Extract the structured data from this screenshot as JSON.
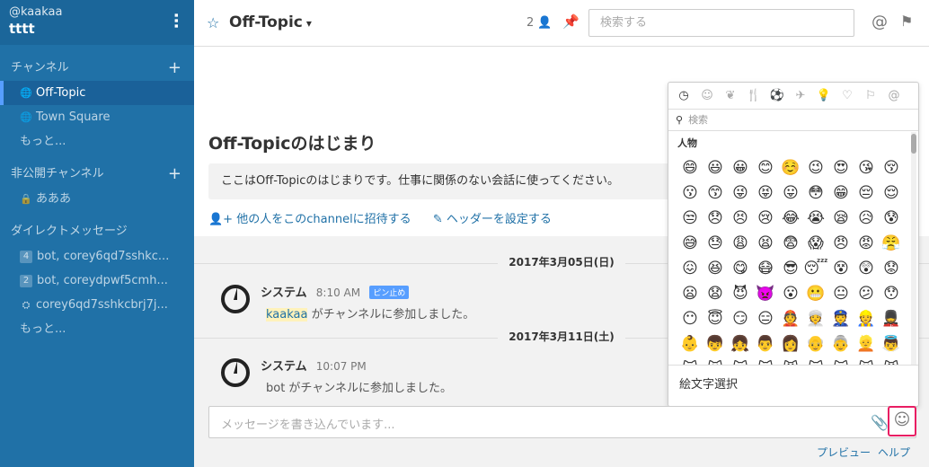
{
  "sidebar": {
    "user": "@kaakaa",
    "team": "tttt",
    "public_heading": "チャンネル",
    "public_items": [
      {
        "label": "Off-Topic",
        "active": true
      },
      {
        "label": "Town Square",
        "active": false
      }
    ],
    "public_more": "もっと...",
    "private_heading": "非公開チャンネル",
    "private_items": [
      {
        "label": "あああ"
      }
    ],
    "dm_heading": "ダイレクトメッセージ",
    "dm_items": [
      {
        "badge": "4",
        "label": "bot, corey6qd7sshkc..."
      },
      {
        "badge": "2",
        "label": "bot, coreydpwf5cmh..."
      },
      {
        "badge": "",
        "label": "corey6qd7sshkcbrj7j..."
      }
    ],
    "dm_more": "もっと..."
  },
  "header": {
    "channel": "Off-Topic",
    "member_count": "2",
    "search_placeholder": "検索する"
  },
  "intro": {
    "title": "Off-Topicのはじまり",
    "description": "ここはOff-Topicのはじまりです。仕事に関係のない会話に使ってください。",
    "invite_link": "他の人をこのchannelに招待する",
    "header_link": "ヘッダーを設定する"
  },
  "posts": [
    {
      "date": "2017年3月05日(日)",
      "user": "システム",
      "time": "8:10 AM",
      "badge": "ピン止め",
      "mention": "kaakaa",
      "text": "がチャンネルに参加しました。"
    },
    {
      "date": "2017年3月11日(土)",
      "user": "システム",
      "time": "10:07 PM",
      "text": "bot がチャンネルに参加しました。"
    }
  ],
  "composer": {
    "placeholder": "メッセージを書き込んでいます..."
  },
  "footer": {
    "preview": "プレビュー",
    "help": "ヘルプ"
  },
  "emoji_picker": {
    "search_placeholder": "検索",
    "category_title": "人物",
    "footer_label": "絵文字選択",
    "categories": [
      "recent-icon",
      "people-icon",
      "nature-icon",
      "food-icon",
      "activity-icon",
      "travel-icon",
      "objects-icon",
      "symbols-icon",
      "flags-icon",
      "custom-icon"
    ],
    "emojis": [
      "😄",
      "😃",
      "😀",
      "😊",
      "☺️",
      "😉",
      "😍",
      "😘",
      "😚",
      "😗",
      "😙",
      "😜",
      "😝",
      "😛",
      "😳",
      "😁",
      "😔",
      "😌",
      "😒",
      "😞",
      "😣",
      "😢",
      "😂",
      "😭",
      "😪",
      "😥",
      "😰",
      "😅",
      "😓",
      "😩",
      "😫",
      "😨",
      "😱",
      "😠",
      "😡",
      "😤",
      "😖",
      "😆",
      "😋",
      "😷",
      "😎",
      "😴",
      "😵",
      "😲",
      "😟",
      "😦",
      "😧",
      "😈",
      "👿",
      "😮",
      "😬",
      "😐",
      "😕",
      "😯",
      "😶",
      "😇",
      "😏",
      "😑",
      "👲",
      "👳",
      "👮",
      "👷",
      "💂",
      "👶",
      "👦",
      "👧",
      "👨",
      "👩",
      "👴",
      "👵",
      "👱",
      "👼",
      "😺",
      "😸",
      "😻",
      "😽",
      "😼",
      "🙀",
      "😿",
      "😹",
      "😾"
    ]
  }
}
